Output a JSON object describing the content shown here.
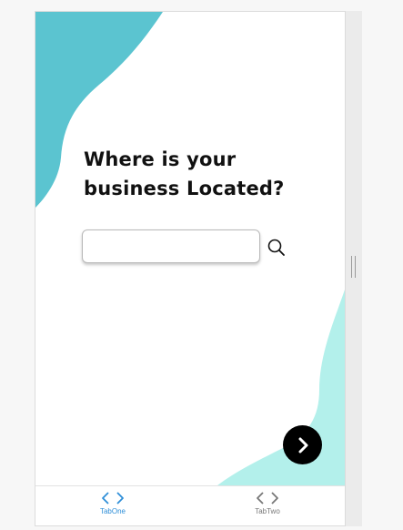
{
  "content": {
    "heading_line1": "Where is your",
    "heading_line2": "business Located?"
  },
  "search": {
    "value": "",
    "placeholder": "",
    "icon": "search-icon"
  },
  "next_button": {
    "icon": "chevron-right-icon"
  },
  "tabbar": {
    "tabs": [
      {
        "label": "TabOne",
        "icon": "code-icon",
        "active": true
      },
      {
        "label": "TabTwo",
        "icon": "code-icon",
        "active": false
      }
    ]
  },
  "colors": {
    "blob_top": "#5bc4d0",
    "blob_bottom": "#b3f0eb",
    "tab_active": "#2f8fd8",
    "tab_inactive": "#777777",
    "next_button_bg": "#000000"
  }
}
